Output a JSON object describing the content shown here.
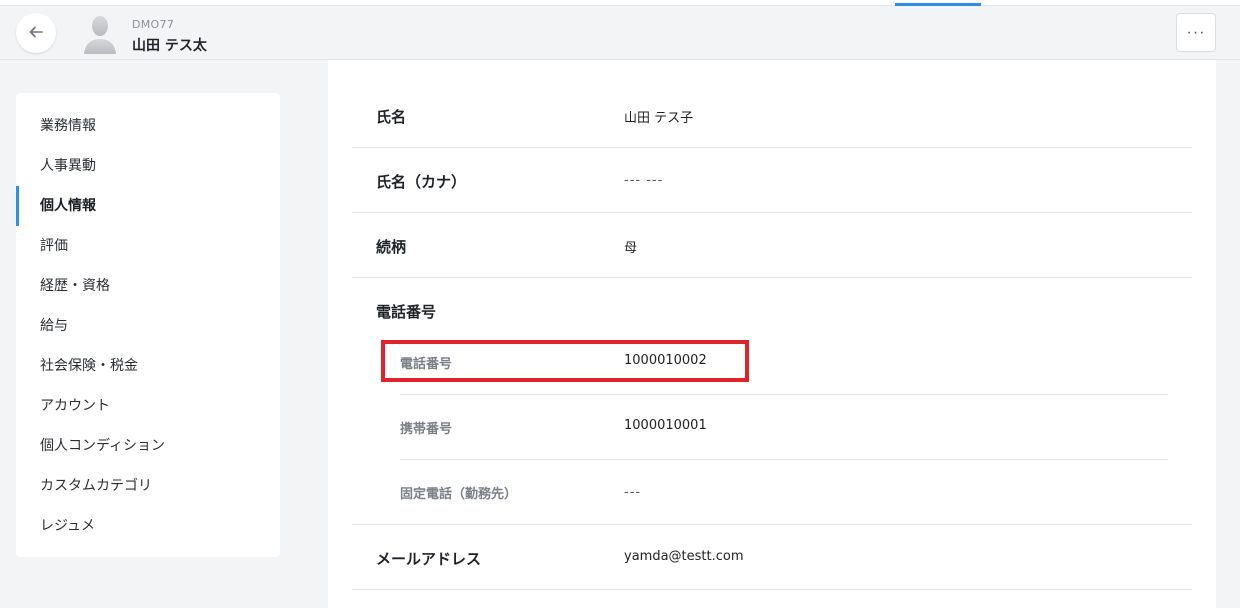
{
  "header": {
    "back_label": "←",
    "employee_code": "DMO77",
    "employee_name": "山田 テス太",
    "more_label": "···"
  },
  "colors": {
    "accent": "#2f8fe8",
    "highlight": "#e0232a",
    "background": "#f3f4f6"
  },
  "sidebar": {
    "items": [
      {
        "label": "業務情報"
      },
      {
        "label": "人事異動"
      },
      {
        "label": "個人情報",
        "active": true
      },
      {
        "label": "評価"
      },
      {
        "label": "経歴・資格"
      },
      {
        "label": "給与"
      },
      {
        "label": "社会保険・税金"
      },
      {
        "label": "アカウント"
      },
      {
        "label": "個人コンディション"
      },
      {
        "label": "カスタムカテゴリ"
      },
      {
        "label": "レジュメ"
      }
    ]
  },
  "details": {
    "name": {
      "label": "氏名",
      "value": "山田 テス子"
    },
    "kana": {
      "label": "氏名（カナ）",
      "value": "--- ---"
    },
    "relation": {
      "label": "続柄",
      "value": "母"
    },
    "phone_section": {
      "label": "電話番号",
      "phone": {
        "label": "電話番号",
        "value": "1000010002"
      },
      "mobile": {
        "label": "携帯番号",
        "value": "1000010001"
      },
      "work": {
        "label": "固定電話（勤務先）",
        "value": "---"
      }
    },
    "email": {
      "label": "メールアドレス",
      "value": "yamda@testt.com"
    }
  }
}
